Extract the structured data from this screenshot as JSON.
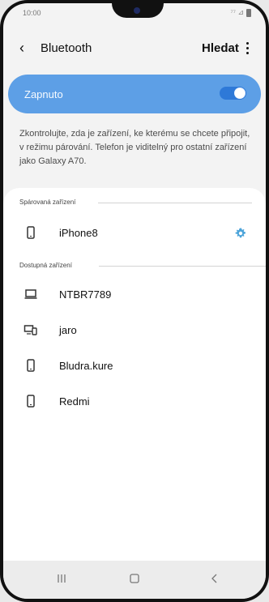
{
  "status_bar": {
    "time": "10:00",
    "signal_text": "⁷⁷ ⊿"
  },
  "toolbar": {
    "title": "Bluetooth",
    "search_label": "Hledat"
  },
  "toggle": {
    "label": "Zapnuto",
    "state": "on",
    "accent_color": "#5d9fe6"
  },
  "description": "Zkontrolujte, zda je zařízení, ke kterému se chcete připojit, v režimu párování. Telefon je viditelný pro ostatní zařízení jako Galaxy A70.",
  "sections": {
    "paired": {
      "title": "Spárovaná zařízení",
      "devices": [
        {
          "name": "iPhone8",
          "icon": "phone-icon"
        }
      ]
    },
    "available": {
      "title": "Dostupná zařízení",
      "devices": [
        {
          "name": "NTBR7789",
          "icon": "laptop-icon"
        },
        {
          "name": "jaro",
          "icon": "monitor-phone-icon"
        },
        {
          "name": "Bludra.kure",
          "icon": "phone-icon"
        },
        {
          "name": "Redmi",
          "icon": "phone-icon"
        }
      ]
    }
  },
  "navigation": {
    "recent_icon": "recent-apps-icon",
    "home_icon": "home-icon",
    "back_icon": "back-icon"
  }
}
